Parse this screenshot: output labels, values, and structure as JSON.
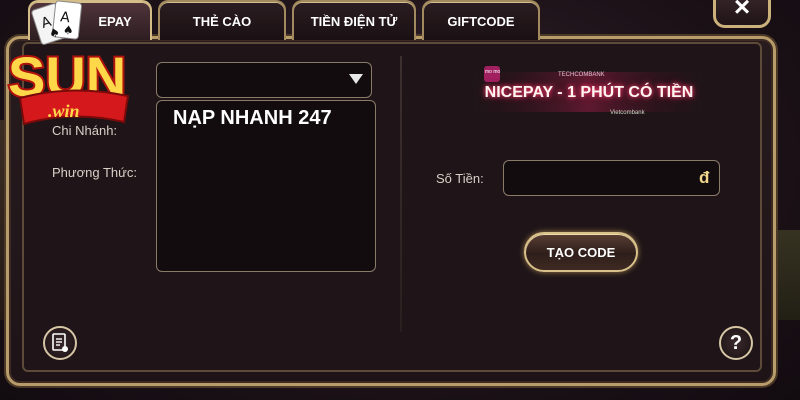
{
  "tabs": [
    {
      "label": "EPAY",
      "active": true
    },
    {
      "label": "THẺ CÀO",
      "active": false
    },
    {
      "label": "TIỀN ĐIỆN TỬ",
      "active": false
    },
    {
      "label": "GIFTCODE",
      "active": false
    }
  ],
  "logo": {
    "text_main": "SUN",
    "text_sub": ".win"
  },
  "close": {
    "icon": "×"
  },
  "form": {
    "branch_label": "Chi Nhánh:",
    "method_label": "Phương Thức:",
    "method_selected": "NẠP NHANH 247"
  },
  "banner": {
    "title": "NICEPAY - 1 PHÚT CÓ TIỀN",
    "momo": "mo mo",
    "techcombank": "TECHCOMBANK",
    "vietcombank": "Vietcombank"
  },
  "amount": {
    "label": "Số Tiền:",
    "value": "",
    "currency": "đ"
  },
  "create_button": {
    "label": "TẠO CODE"
  },
  "help": {
    "icon": "?"
  },
  "colors": {
    "accent": "#b89c6a",
    "panel": "#1e1417",
    "neon": "#ff3a6a"
  }
}
